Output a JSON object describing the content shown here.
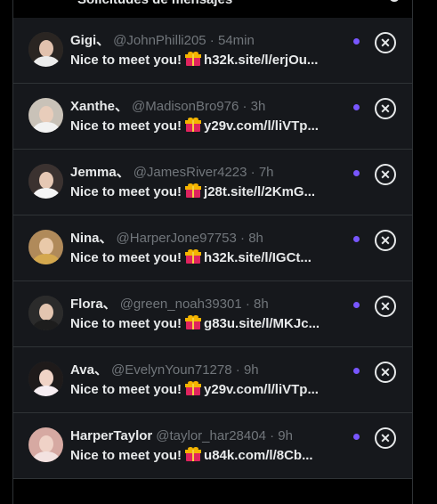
{
  "header": {
    "title": "Solicitudes de mensajes"
  },
  "accent": "#7856ff",
  "requests": [
    {
      "name": "Gigi、",
      "handle": "@JohnPhilli205",
      "time": "54min",
      "message": "Nice to meet you!",
      "link": "h32k.site/l/erjOu",
      "ellipsis": "...",
      "avatar": {
        "hair": "#2a2522",
        "body": "#ececec",
        "skin": "#e2c2ae"
      }
    },
    {
      "name": "Xanthe、",
      "handle": "@MadisonBro976",
      "time": "3h",
      "message": "Nice to meet you!",
      "link": "y29v.com/l/liVTp",
      "ellipsis": "...",
      "avatar": {
        "hair": "#c9c2b8",
        "body": "#f2f2f2",
        "skin": "#e8cdbb"
      }
    },
    {
      "name": "Jemma、",
      "handle": "@JamesRiver4223",
      "time": "7h",
      "message": "Nice to meet you!",
      "link": "j28t.site/l/2KmG",
      "ellipsis": "...",
      "avatar": {
        "hair": "#3b3230",
        "body": "#f5f5f5",
        "skin": "#e6c8b4"
      }
    },
    {
      "name": "Nina、",
      "handle": "@HarperJone97753",
      "time": "8h",
      "message": "Nice to meet you!",
      "link": "h32k.site/l/IGCt",
      "ellipsis": "...",
      "avatar": {
        "hair": "#b08a5a",
        "body": "#d4a84e",
        "skin": "#e9c9a9"
      }
    },
    {
      "name": "Flora、",
      "handle": "@green_noah39301",
      "time": "8h",
      "message": "Nice to meet you!",
      "link": "g83u.site/l/MKJc",
      "ellipsis": "...",
      "avatar": {
        "hair": "#2b2b2b",
        "body": "#1d1d1d",
        "skin": "#e3c5b0"
      }
    },
    {
      "name": "Ava、",
      "handle": "@EvelynYoun71278",
      "time": "9h",
      "message": "Nice to meet you!",
      "link": "y29v.com/l/liVTp",
      "ellipsis": "...",
      "avatar": {
        "hair": "#1e1a1a",
        "body": "#f7eef2",
        "skin": "#f0d3c6"
      }
    },
    {
      "name": "HarperTaylor",
      "handle": "@taylor_har28404",
      "time": "9h",
      "message": "Nice to meet you!",
      "link": "u84k.com/l/8Cb",
      "ellipsis": "...",
      "avatar": {
        "hair": "#d6a9a2",
        "body": "#f3e2e0",
        "skin": "#efd2c7"
      }
    }
  ]
}
